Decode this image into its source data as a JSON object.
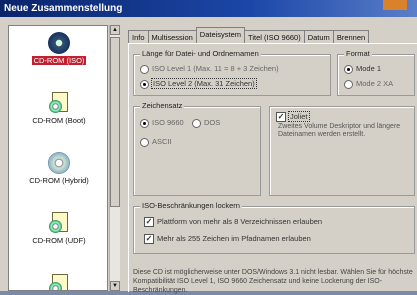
{
  "window": {
    "title": "Neue Zusammenstellung"
  },
  "left_list": {
    "items": [
      {
        "label": "CD-ROM (ISO)",
        "selected": true,
        "icon": "cd-disc-icon"
      },
      {
        "label": "CD-ROM (Boot)",
        "selected": false,
        "icon": "boot-document-icon"
      },
      {
        "label": "CD-ROM (Hybrid)",
        "selected": false,
        "icon": "cd-disc-icon"
      },
      {
        "label": "CD-ROM (UDF)",
        "selected": false,
        "icon": "udf-document-icon"
      }
    ]
  },
  "tabs": [
    {
      "label": "Info",
      "active": false
    },
    {
      "label": "Multisession",
      "active": false
    },
    {
      "label": "Dateisystem",
      "active": true
    },
    {
      "label": "Titel (ISO 9660)",
      "active": false
    },
    {
      "label": "Datum",
      "active": false
    },
    {
      "label": "Brennen",
      "active": false
    }
  ],
  "filename_length": {
    "title": "Länge für Datei- und Ordnernamen",
    "options": [
      {
        "label": "ISO Level 1 (Max. 11 = 8 + 3 Zeichen)",
        "checked": false
      },
      {
        "label": "ISO Level 2 (Max. 31 Zeichen)",
        "checked": true
      }
    ]
  },
  "format": {
    "title": "Format",
    "options": [
      {
        "label": "Mode 1",
        "checked": true
      },
      {
        "label": "Mode 2 XA",
        "checked": false
      }
    ]
  },
  "charset": {
    "title": "Zeichensatz",
    "options": [
      {
        "label": "ISO 9660",
        "checked": true
      },
      {
        "label": "DOS",
        "checked": false
      },
      {
        "label": "ASCII",
        "checked": false
      }
    ]
  },
  "joliet": {
    "label": "Joliet",
    "checked": true,
    "description": "Zweites Volume Deskriptor und längere Dateinamen werden erstellt."
  },
  "iso_limits": {
    "title": "ISO-Beschränkungen lockern",
    "options": [
      {
        "label": "Plattform von mehr als 8 Verzeichnissen erlauben",
        "checked": true
      },
      {
        "label": "Mehr als 255 Zeichen im Pfadnamen erlauben",
        "checked": true
      }
    ]
  },
  "info_text": "Diese CD ist möglicherweise unter DOS/Windows 3.1 nicht lesbar. Wählen Sie für höchste Kompatibilität ISO Level 1, ISO 9660 Zeichensatz und keine Lockerung der ISO-Beschränkungen."
}
